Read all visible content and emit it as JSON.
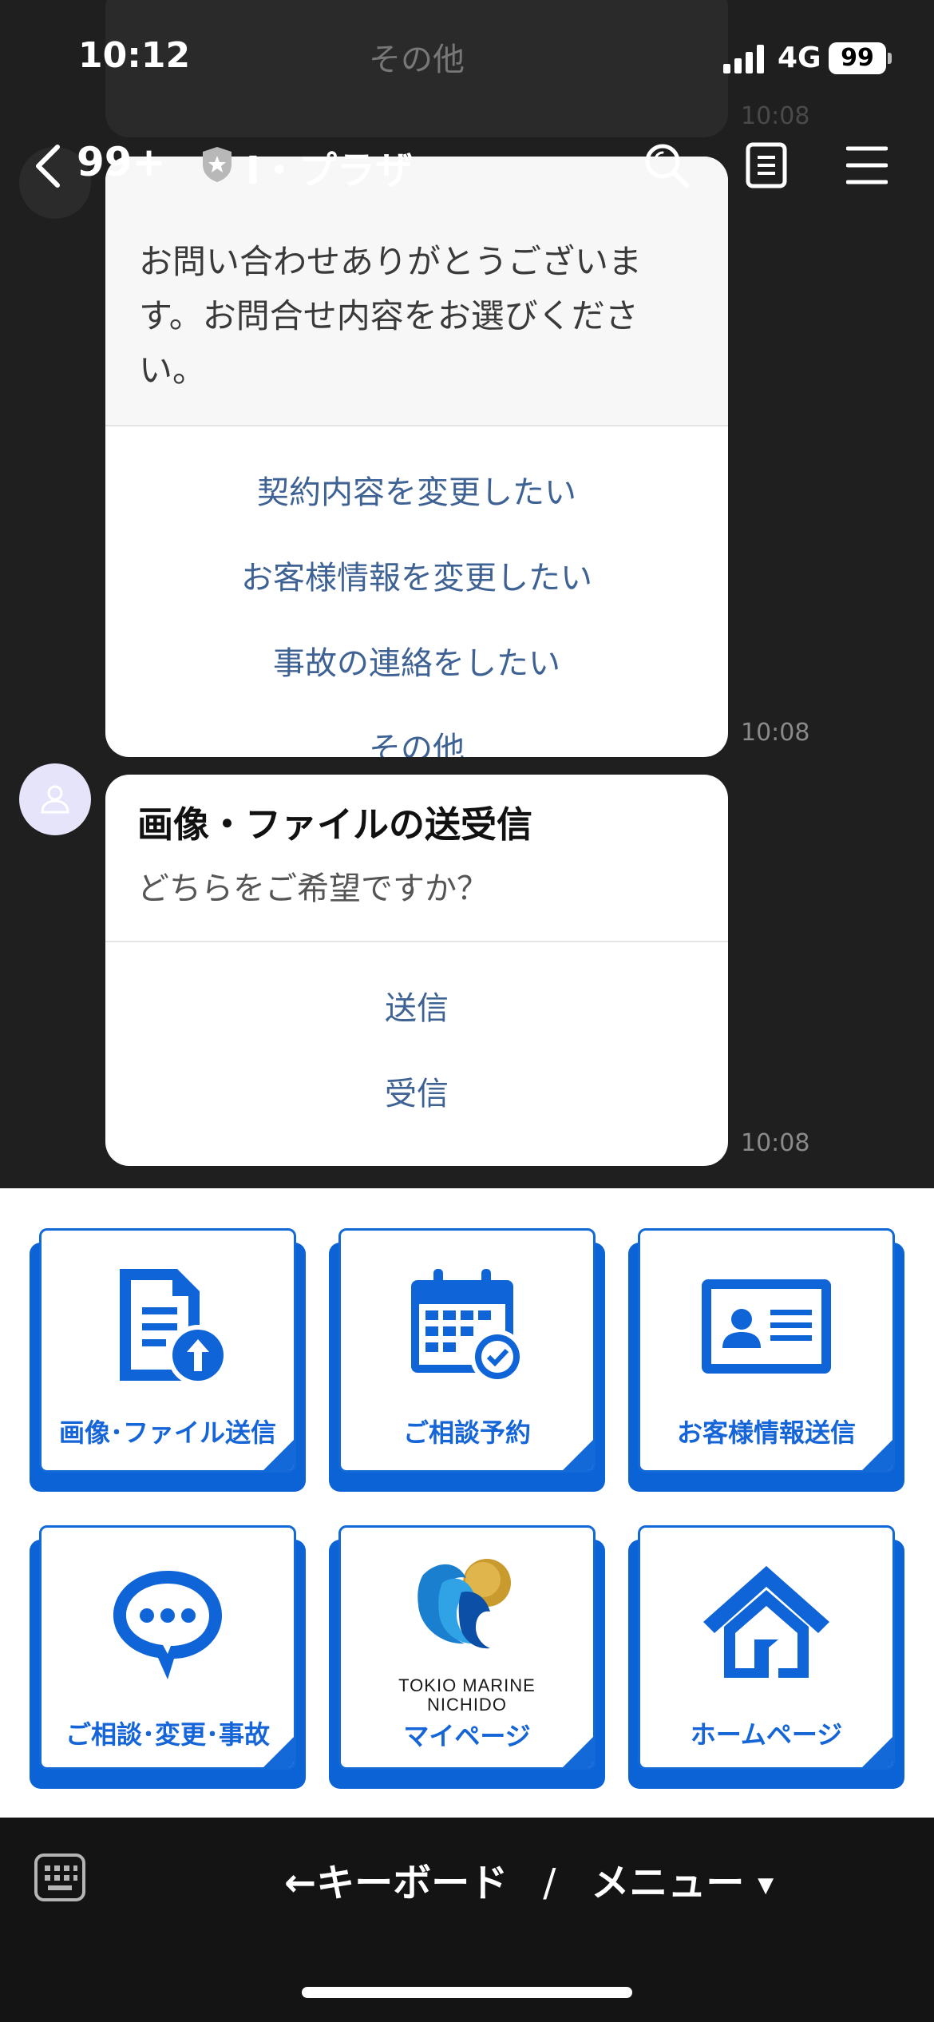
{
  "status_bar": {
    "time": "10:12",
    "network": "4G",
    "battery": "99"
  },
  "header": {
    "unread_count": "99+",
    "channel_name": "I・プラザ"
  },
  "chat": {
    "ghost_option": "その他",
    "ghost_time": "10:08",
    "message1": {
      "text": "お問い合わせありがとうございます。お問合せ内容をお選びください。",
      "options": [
        "契約内容を変更したい",
        "お客様情報を変更したい",
        "事故の連絡をしたい",
        "その他"
      ],
      "time": "10:08"
    },
    "message2": {
      "title": "画像・ファイルの送受信",
      "subtitle": "どちらをご希望ですか？",
      "options": [
        "送信",
        "受信"
      ],
      "time": "10:08"
    }
  },
  "rich_menu": {
    "items": [
      {
        "label": "画像･ファイル送信",
        "icon": "document-upload-icon"
      },
      {
        "label": "ご相談予約",
        "icon": "calendar-check-icon"
      },
      {
        "label": "お客様情報送信",
        "icon": "id-card-icon"
      },
      {
        "label": "ご相談･変更･事故",
        "icon": "chat-bubble-icon"
      },
      {
        "label": "マイページ",
        "icon": "tokio-marine-logo",
        "logo_line1": "TOKIO MARINE",
        "logo_line2": "NICHIDO"
      },
      {
        "label": "ホームページ",
        "icon": "house-icon"
      }
    ],
    "accent_color": "#1469d9"
  },
  "bottom_bar": {
    "keyboard_label": "←キーボード",
    "separator": "/",
    "menu_label": "メニュー",
    "menu_caret": "▼"
  }
}
